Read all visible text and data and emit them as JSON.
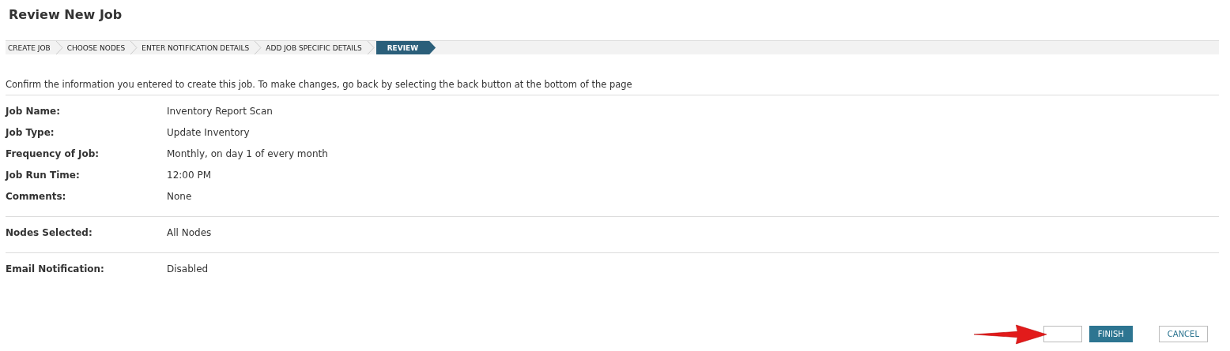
{
  "page": {
    "title": "Review New Job"
  },
  "steps": [
    {
      "label": "CREATE JOB",
      "selected": false
    },
    {
      "label": "CHOOSE NODES",
      "selected": false
    },
    {
      "label": "ENTER NOTIFICATION DETAILS",
      "selected": false
    },
    {
      "label": "ADD JOB SPECIFIC DETAILS",
      "selected": false
    },
    {
      "label": "REVIEW",
      "selected": true
    }
  ],
  "intro": "Confirm the information you entered to create this job. To make changes, go back by selecting the back button at the bottom of the page",
  "sections": [
    {
      "rows": [
        {
          "label": "Job Name:",
          "value": "Inventory Report Scan"
        },
        {
          "label": "Job Type:",
          "value": "Update Inventory"
        },
        {
          "label": "Frequency of Job:",
          "value": "Monthly, on day 1 of every month"
        },
        {
          "label": "Job Run Time:",
          "value": "12:00 PM"
        },
        {
          "label": "Comments:",
          "value": "None"
        }
      ]
    },
    {
      "rows": [
        {
          "label": "Nodes Selected:",
          "value": "All Nodes"
        }
      ]
    },
    {
      "rows": [
        {
          "label": "Email Notification:",
          "value": "Disabled"
        }
      ]
    }
  ],
  "buttons": [
    {
      "kind": "covered"
    },
    {
      "kind": "primary",
      "label": "FINISH"
    },
    {
      "kind": "secondary",
      "label": "CANCEL"
    }
  ]
}
